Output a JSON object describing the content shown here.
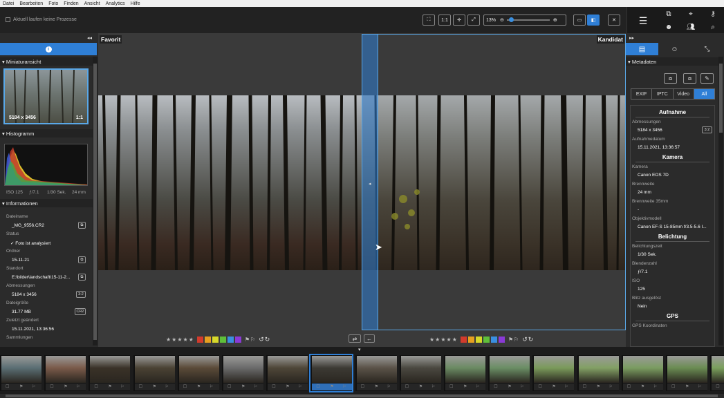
{
  "menu": [
    "Datei",
    "Bearbeiten",
    "Foto",
    "Finden",
    "Ansicht",
    "Analytics",
    "Hilfe"
  ],
  "toolbar": {
    "process_status": "Aktuell laufen keine Prozesse",
    "btn_fit": "⛶",
    "btn_1to1": "1:1",
    "btn_center": "✛",
    "btn_expand": "⤢",
    "zoom_value": "13%",
    "zoom_level": 0.05
  },
  "left": {
    "thumb_section": "Miniaturansicht",
    "thumb_dims": "5184 x 3456",
    "thumb_ratio": "1:1",
    "histogram_section": "Histogramm",
    "hist_iso": "ISO 125",
    "hist_aperture": "ƒ/7.1",
    "hist_shutter": "1/30 Sek.",
    "hist_focal": "24 mm",
    "info_section": "Informationen",
    "fields": [
      {
        "label": "Dateiname",
        "value": "_MG_9556.CR2",
        "btn": "⧉"
      },
      {
        "label": "Status",
        "value": "Foto ist analysiert",
        "btn": ""
      },
      {
        "label": "Ordner",
        "value": "15-11-21",
        "btn": "⧉"
      },
      {
        "label": "Standort",
        "value": "E:\\bilder\\landschaft\\15-11-2...",
        "btn": "⧉"
      },
      {
        "label": "Abmessungen",
        "value": "5184 x 3456",
        "btn": "3:2"
      },
      {
        "label": "Dateigröße",
        "value": "31.77 MB",
        "btn": "CR2"
      },
      {
        "label": "Zuletzt geändert",
        "value": "15.11.2021, 13:36:56",
        "btn": ""
      },
      {
        "label": "Sammlungen",
        "value": "",
        "btn": ""
      }
    ]
  },
  "center": {
    "label_left": "Favorit",
    "label_right": "Kandidat"
  },
  "right": {
    "section": "Metadaten",
    "tabs": [
      "EXIF",
      "IPTC",
      "Video",
      "All"
    ],
    "groups": [
      {
        "title": "Aufnahme",
        "items": [
          {
            "label": "Abmessungen",
            "value": "5184 x 3456",
            "badge": "3:2"
          },
          {
            "label": "Aufnahmedatum",
            "value": "15.11.2021, 13:36:57",
            "badge": ""
          }
        ]
      },
      {
        "title": "Kamera",
        "items": [
          {
            "label": "Kamera",
            "value": "Canon EOS 7D",
            "badge": ""
          },
          {
            "label": "Brennweite",
            "value": "24 mm",
            "badge": ""
          },
          {
            "label": "Brennweite 35mm",
            "value": "-",
            "badge": ""
          },
          {
            "label": "Objektivmodell",
            "value": "Canon EF-S 15-85mm f/3.5-5.6 I...",
            "badge": ""
          }
        ]
      },
      {
        "title": "Belichtung",
        "items": [
          {
            "label": "Belichtungszeit",
            "value": "1/30 Sek.",
            "badge": ""
          },
          {
            "label": "Blendenzahl",
            "value": "ƒ/7.1",
            "badge": ""
          },
          {
            "label": "ISO",
            "value": "125",
            "badge": ""
          },
          {
            "label": "Blitz ausgelöst",
            "value": "Nein",
            "badge": ""
          }
        ]
      },
      {
        "title": "GPS",
        "items": [
          {
            "label": "GPS Koordinaten",
            "value": "",
            "badge": ""
          }
        ]
      }
    ]
  },
  "colors": {
    "accent": "#2f7fd6",
    "labels": [
      "#d23b2c",
      "#e6a020",
      "#d6d82a",
      "#5fbf3a",
      "#3a8fe0",
      "#8a3ad6"
    ]
  },
  "filmstrip": {
    "thumbs": [
      {
        "color": "#5a6e74",
        "selected": false
      },
      {
        "color": "#7a5a4a",
        "selected": false
      },
      {
        "color": "#3a3228",
        "selected": false
      },
      {
        "color": "#4a4234",
        "selected": false
      },
      {
        "color": "#5a4a38",
        "selected": false
      },
      {
        "color": "#6a6a6a",
        "selected": false
      },
      {
        "color": "#4e4638",
        "selected": false
      },
      {
        "color": "#3c3a34",
        "selected": true
      },
      {
        "color": "#5a5248",
        "selected": false
      },
      {
        "color": "#4a4840",
        "selected": false
      },
      {
        "color": "#6a8a62",
        "selected": false
      },
      {
        "color": "#6a8e64",
        "selected": false
      },
      {
        "color": "#7a9a5a",
        "selected": false
      },
      {
        "color": "#82a064",
        "selected": false
      },
      {
        "color": "#7a9c60",
        "selected": false
      },
      {
        "color": "#6a8c52",
        "selected": false
      },
      {
        "color": "#7aa05c",
        "selected": false
      }
    ]
  }
}
